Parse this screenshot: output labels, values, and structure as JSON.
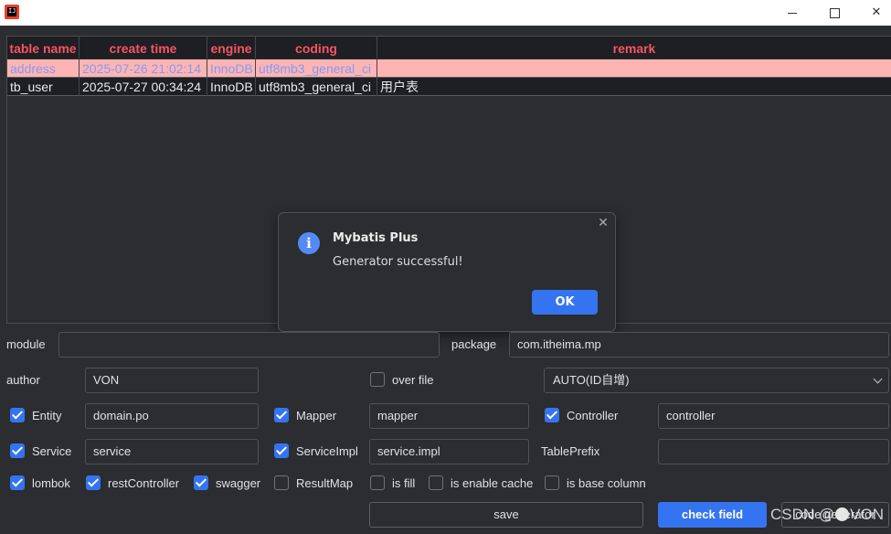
{
  "window": {
    "app_icon_text": "IJ",
    "minimize": "",
    "maximize": "",
    "close": "✕"
  },
  "table": {
    "headers": [
      "table name",
      "create time",
      "engine",
      "coding",
      "remark"
    ],
    "rows": [
      [
        "address",
        "2025-07-26 21:02:14",
        "InnoDB",
        "utf8mb3_general_ci",
        ""
      ],
      [
        "tb_user",
        "2025-07-27 00:34:24",
        "InnoDB",
        "utf8mb3_general_ci",
        "用户表"
      ]
    ],
    "selected_row": 0
  },
  "dialog": {
    "icon": "info-icon",
    "title": "Mybatis Plus",
    "message": "Generator successful!",
    "ok_label": "OK",
    "close": "✕"
  },
  "form": {
    "module_label": "module",
    "module_value": "",
    "package_label": "package",
    "package_value": "com.itheima.mp",
    "author_label": "author",
    "author_value": "VON",
    "over_file_label": "over file",
    "over_file_checked": false,
    "id_type_value": "AUTO(ID自增)",
    "entity_label": "Entity",
    "entity_value": "domain.po",
    "mapper_label": "Mapper",
    "mapper_value": "mapper",
    "controller_label": "Controller",
    "controller_value": "controller",
    "service_label": "Service",
    "service_value": "service",
    "service_impl_label": "ServiceImpl",
    "service_impl_value": "service.impl",
    "table_prefix_label": "TablePrefix",
    "table_prefix_value": "",
    "lombok_label": "lombok",
    "rest_controller_label": "restController",
    "swagger_label": "swagger",
    "result_map_label": "ResultMap",
    "is_fill_label": "is fill",
    "is_enable_cache_label": "is enable cache",
    "is_base_column_label": "is base column"
  },
  "buttons": {
    "save": "save",
    "check_field": "check field",
    "code_generator": "code generator"
  },
  "watermark": {
    "left": "CSDN @",
    "right": "VON"
  },
  "colors": {
    "accent": "#3574f0",
    "header_text": "#f75464",
    "selected_row_bg": "#ffb4b4",
    "selected_row_text": "#7f9cf5"
  }
}
